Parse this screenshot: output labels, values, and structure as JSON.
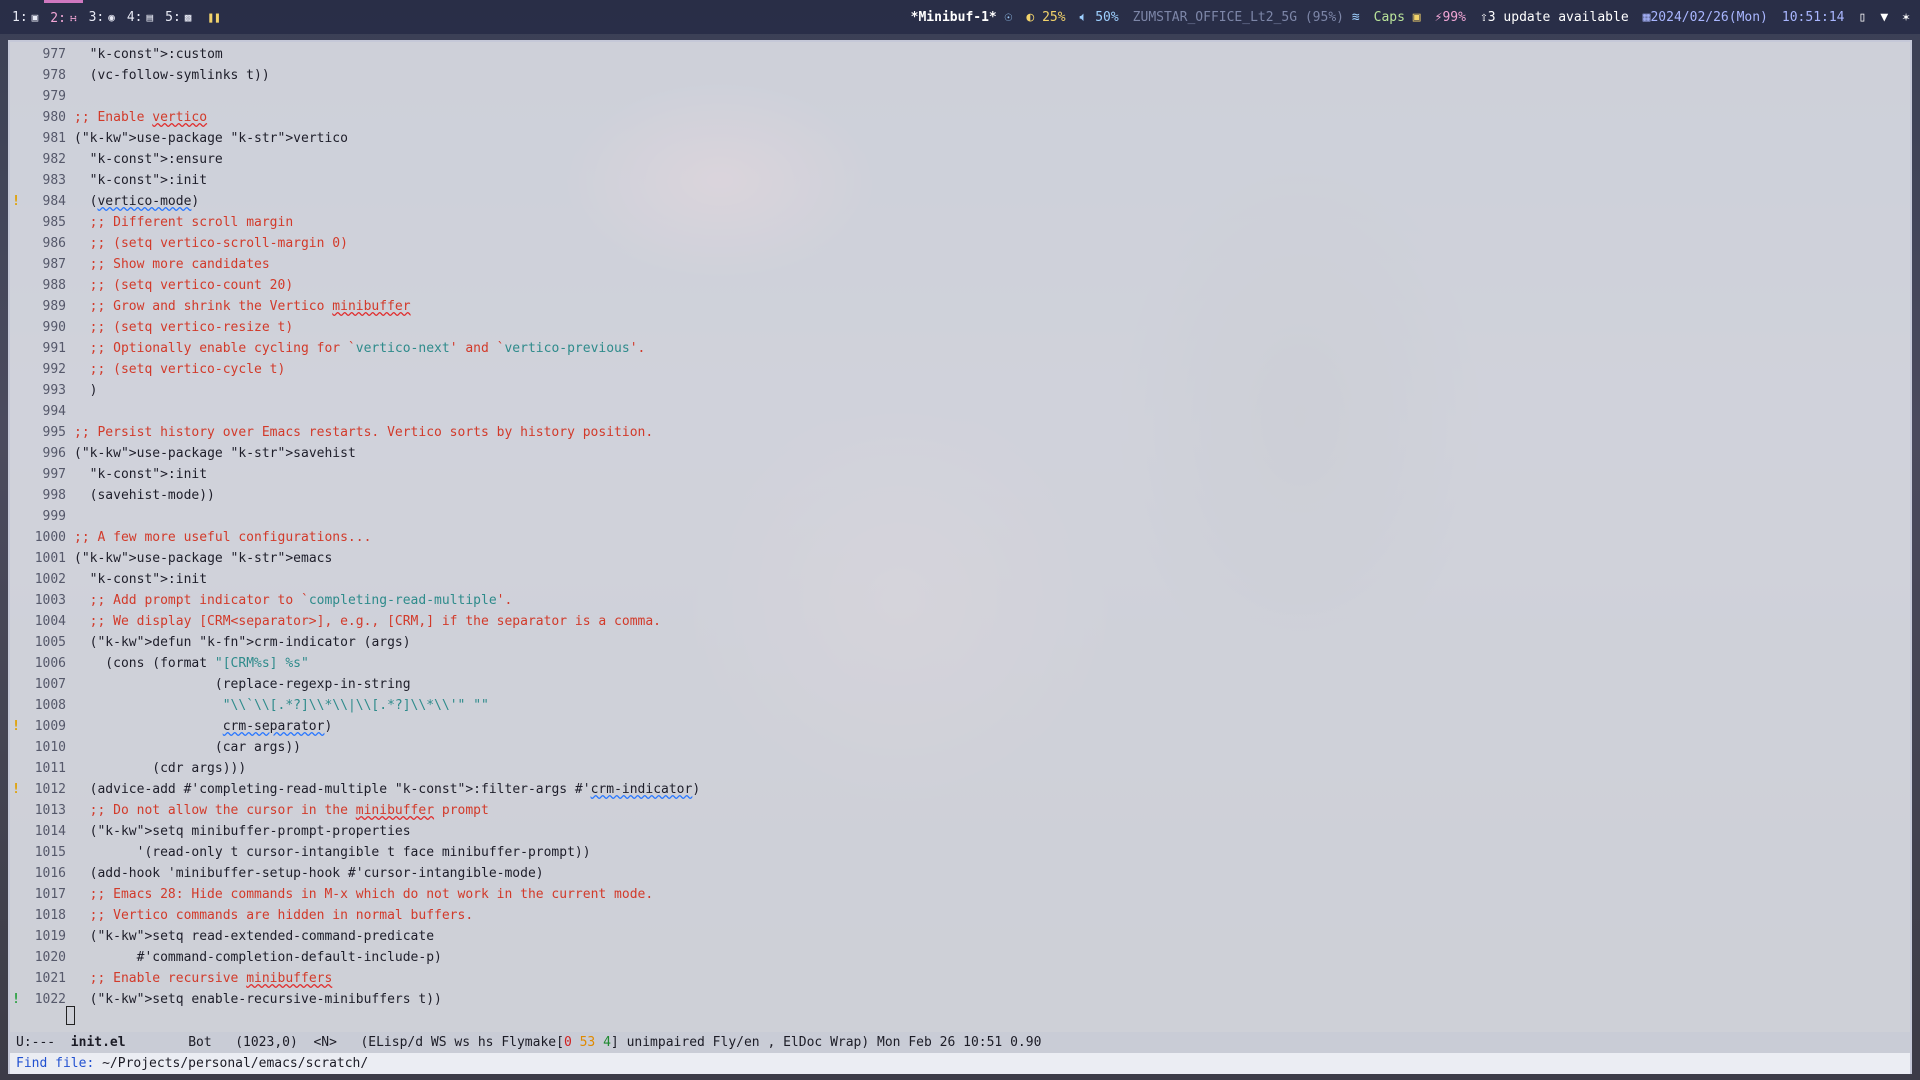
{
  "topbar": {
    "workspaces": [
      {
        "label": "1:",
        "icon": "terminal-icon"
      },
      {
        "label": "2:",
        "icon": "code-icon",
        "active": true
      },
      {
        "label": "3:",
        "icon": "globe-icon"
      },
      {
        "label": "4:",
        "icon": "chat-icon"
      },
      {
        "label": "5:",
        "icon": "file-icon"
      }
    ],
    "window_title": "*Minibuf-1*",
    "brightness": "25%",
    "volume": "50%",
    "wifi": "ZUMSTAR_OFFICE_Lt2_5G (95%)",
    "caps": "Caps",
    "battery": "99%",
    "updates": "3 update available",
    "date": "2024/02/26(Mon)",
    "time": "10:51:14"
  },
  "editor": {
    "lines": [
      {
        "n": "977",
        "t": "  :custom"
      },
      {
        "n": "978",
        "t": "  (vc-follow-symlinks t))"
      },
      {
        "n": "979",
        "t": ""
      },
      {
        "n": "980",
        "t": ";; Enable vertico"
      },
      {
        "n": "981",
        "t": "(use-package vertico"
      },
      {
        "n": "982",
        "t": "  :ensure"
      },
      {
        "n": "983",
        "t": "  :init"
      },
      {
        "n": "984",
        "t": "  (vertico-mode)",
        "fringe": "!"
      },
      {
        "n": "985",
        "t": "  ;; Different scroll margin"
      },
      {
        "n": "986",
        "t": "  ;; (setq vertico-scroll-margin 0)"
      },
      {
        "n": "987",
        "t": "  ;; Show more candidates"
      },
      {
        "n": "988",
        "t": "  ;; (setq vertico-count 20)"
      },
      {
        "n": "989",
        "t": "  ;; Grow and shrink the Vertico minibuffer"
      },
      {
        "n": "990",
        "t": "  ;; (setq vertico-resize t)"
      },
      {
        "n": "991",
        "t": "  ;; Optionally enable cycling for `vertico-next' and `vertico-previous'."
      },
      {
        "n": "992",
        "t": "  ;; (setq vertico-cycle t)"
      },
      {
        "n": "993",
        "t": "  )"
      },
      {
        "n": "994",
        "t": ""
      },
      {
        "n": "995",
        "t": ";; Persist history over Emacs restarts. Vertico sorts by history position."
      },
      {
        "n": "996",
        "t": "(use-package savehist"
      },
      {
        "n": "997",
        "t": "  :init"
      },
      {
        "n": "998",
        "t": "  (savehist-mode))"
      },
      {
        "n": "999",
        "t": ""
      },
      {
        "n": "1000",
        "t": ";; A few more useful configurations..."
      },
      {
        "n": "1001",
        "t": "(use-package emacs"
      },
      {
        "n": "1002",
        "t": "  :init"
      },
      {
        "n": "1003",
        "t": "  ;; Add prompt indicator to `completing-read-multiple'."
      },
      {
        "n": "1004",
        "t": "  ;; We display [CRM<separator>], e.g., [CRM,] if the separator is a comma."
      },
      {
        "n": "1005",
        "t": "  (defun crm-indicator (args)"
      },
      {
        "n": "1006",
        "t": "    (cons (format \"[CRM%s] %s\""
      },
      {
        "n": "1007",
        "t": "                  (replace-regexp-in-string"
      },
      {
        "n": "1008",
        "t": "                   \"\\\\`\\\\[.*?]\\\\*\\\\|\\\\[.*?]\\\\*\\\\'\" \"\""
      },
      {
        "n": "1009",
        "t": "                   crm-separator)",
        "fringe": "!"
      },
      {
        "n": "1010",
        "t": "                  (car args))"
      },
      {
        "n": "1011",
        "t": "          (cdr args)))"
      },
      {
        "n": "1012",
        "t": "  (advice-add #'completing-read-multiple :filter-args #'crm-indicator)",
        "fringe": "!"
      },
      {
        "n": "1013",
        "t": "  ;; Do not allow the cursor in the minibuffer prompt"
      },
      {
        "n": "1014",
        "t": "  (setq minibuffer-prompt-properties"
      },
      {
        "n": "1015",
        "t": "        '(read-only t cursor-intangible t face minibuffer-prompt))"
      },
      {
        "n": "1016",
        "t": "  (add-hook 'minibuffer-setup-hook #'cursor-intangible-mode)"
      },
      {
        "n": "1017",
        "t": "  ;; Emacs 28: Hide commands in M-x which do not work in the current mode."
      },
      {
        "n": "1018",
        "t": "  ;; Vertico commands are hidden in normal buffers."
      },
      {
        "n": "1019",
        "t": "  (setq read-extended-command-predicate"
      },
      {
        "n": "1020",
        "t": "        #'command-completion-default-include-p)"
      },
      {
        "n": "1021",
        "t": "  ;; Enable recursive minibuffers"
      },
      {
        "n": "1022",
        "t": "  (setq enable-recursive-minibuffers t))",
        "fringe": "!"
      }
    ]
  },
  "modeline": {
    "state": "U:---",
    "file": "init.el",
    "position": "Bot",
    "cursor": "(1023,0)",
    "evil": "<N>",
    "modes_prefix": "(ELisp/",
    "modes_mid": "d WS ws hs Flymake[",
    "fm_errors": "0",
    "fm_warnings": "53",
    "fm_notes": "4",
    "modes_suffix": "] unimpaired Fly/en , ElDoc Wrap)",
    "datetime": "Mon Feb 26 10:51 0.90"
  },
  "minibuffer": {
    "prompt": "Find file: ",
    "value": "~/Projects/personal/emacs/scratch/"
  },
  "colors": {
    "comment": "#d23a2a",
    "keyword": "#8a3ab9",
    "function": "#2150d0",
    "string": "#2e8b8b",
    "active_workspace": "#d078c0"
  }
}
